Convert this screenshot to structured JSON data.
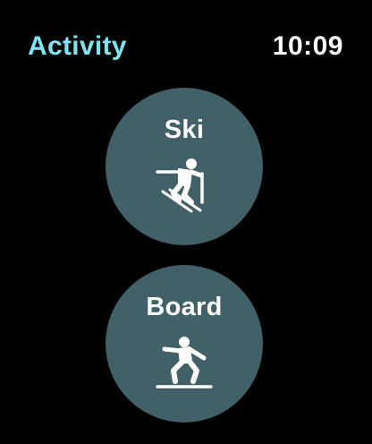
{
  "header": {
    "title": "Activity",
    "time": "10:09"
  },
  "colors": {
    "title": "#7fe4f2",
    "button_bg": "#426067",
    "background": "#000000"
  },
  "activities": [
    {
      "label": "Ski",
      "icon": "skier-icon"
    },
    {
      "label": "Board",
      "icon": "snowboarder-icon"
    }
  ]
}
